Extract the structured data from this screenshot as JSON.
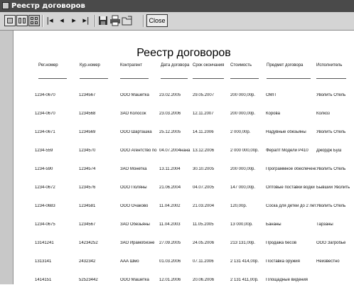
{
  "window": {
    "title": "Реестр договоров"
  },
  "toolbar": {
    "buttons": [
      {
        "icon": "single-page-icon"
      },
      {
        "icon": "two-page-icon"
      },
      {
        "icon": "multi-page-icon"
      },
      {
        "icon": "first-page-icon",
        "glyph": "|◂"
      },
      {
        "icon": "prev-page-icon",
        "glyph": "◂"
      },
      {
        "icon": "next-page-icon",
        "glyph": "▸"
      },
      {
        "icon": "last-page-icon",
        "glyph": "▸|"
      },
      {
        "icon": "save-icon"
      },
      {
        "icon": "print-icon"
      },
      {
        "icon": "open-icon"
      }
    ],
    "close_label": "Close"
  },
  "report": {
    "title": "Реестр договоров",
    "columns": [
      "Рег.номер",
      "Кур.номер",
      "Контрагент",
      "Дата договора",
      "Срок окончания",
      "Стоимость",
      "Предмет договора",
      "Исполнитель"
    ],
    "rows": [
      [
        "1234-0670",
        "1234567",
        "ООО Машетка",
        "23.02.2005",
        "29.05.2007",
        "200 000,00р.",
        "ОМП",
        "Уволить Отель"
      ],
      [
        "1234-0670",
        "1234568",
        "ЗАО Колосок",
        "23.03.2006",
        "12.11.2007",
        "200 000,00р.",
        "Корова",
        "Колкоз"
      ],
      [
        "1234-0671",
        "1234569",
        "ООО Шарташка",
        "25.12.2005",
        "14.11.2006",
        "2 000,00р.",
        "Надувные обезьяны",
        "Уволить Отель"
      ],
      [
        "1234-559",
        "1234570",
        "ООО Агентство по",
        "04.07.2004нана",
        "13.12.2006",
        "2 000 000,00р.",
        "Ферапт Модели Р410",
        "Джордж Буш"
      ],
      [
        "1234-590",
        "1234574",
        "ЗАО Монетка",
        "13.11.2004",
        "30.10.2005",
        "200 000,00р.",
        "Программное обеспечение",
        "Уволить Отель"
      ],
      [
        "1234-0672",
        "1234576",
        "ООО Поляны",
        "21.06.2004",
        "04.07.2005",
        "147 000,00р.",
        "Оптовые поставки водки",
        "Бывший Уволить"
      ],
      [
        "1234-0683",
        "1234581",
        "ООО Очаково",
        "11.04.2002",
        "21.03.2004",
        "120,00р.",
        "Соска для детей до 2 лет",
        "Уволить Отель"
      ],
      [
        "1234-0675",
        "1234567",
        "ЗАО Обезьяны",
        "11.04.2003",
        "11.05.2005",
        "13 000,00р.",
        "Бананы",
        "Тарзаны"
      ],
      [
        "13141241",
        "14234252",
        "ЗАО Ирамобизне",
        "27.09.2005",
        "24.05.2006",
        "213 131,00р.",
        "Продажа бесов",
        "ООО Загробье"
      ],
      [
        "1313141",
        "2432342",
        "ААА Шмо",
        "01.03.2006",
        "07.11.2006",
        "2 131 414,00р.",
        "Поставка оружия",
        "Неизвестно"
      ],
      [
        "1414151",
        "52523442",
        "ООО Машетка",
        "12.01.2006",
        "20.06.2006",
        "2 131 411,00р.",
        "Площадные видения",
        ""
      ]
    ]
  }
}
